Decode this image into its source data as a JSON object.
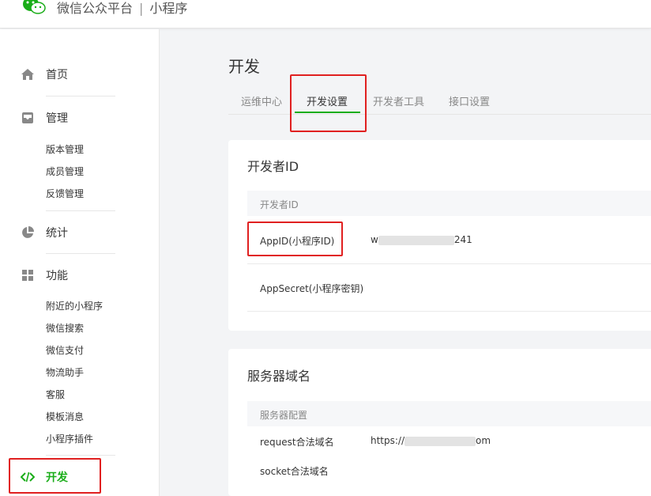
{
  "header": {
    "brand": "微信公众平台",
    "separator": "|",
    "product": "小程序"
  },
  "sidebar": {
    "home": "首页",
    "manage": "管理",
    "manage_items": [
      "版本管理",
      "成员管理",
      "反馈管理"
    ],
    "stats": "统计",
    "features": "功能",
    "feature_items": [
      "附近的小程序",
      "微信搜索",
      "微信支付",
      "物流助手",
      "客服",
      "模板消息",
      "小程序插件"
    ],
    "dev": "开发"
  },
  "page": {
    "title": "开发",
    "tabs": [
      "运维中心",
      "开发设置",
      "开发者工具",
      "接口设置"
    ],
    "active_tab": "开发设置"
  },
  "developer_card": {
    "title": "开发者ID",
    "table_head": "开发者ID",
    "appid_label": "AppID(小程序ID)",
    "appid_prefix": "w",
    "appid_suffix": "241",
    "appsecret_label": "AppSecret(小程序密钥)"
  },
  "server_card": {
    "title": "服务器域名",
    "table_head": "服务器配置",
    "request_label": "request合法域名",
    "request_prefix": "https://",
    "request_suffix": "om",
    "socket_label": "socket合法域名"
  },
  "colors": {
    "accent": "#1aad19",
    "highlight": "#e02020"
  }
}
